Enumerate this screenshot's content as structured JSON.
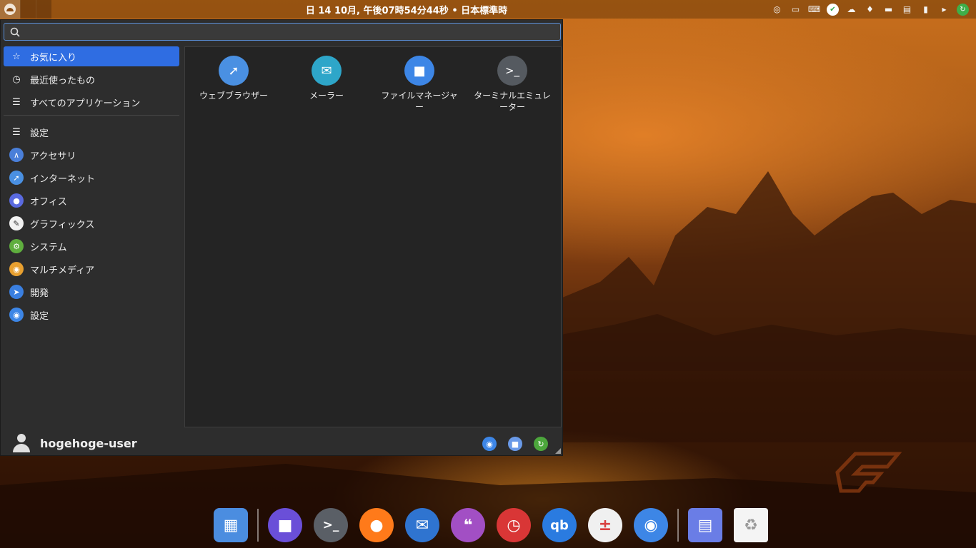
{
  "top_panel": {
    "clock_text": "日 14 10月, 午後07時54分44秒 • 日本標準時",
    "tray_icons": [
      "lightbulb-icon",
      "display-icon",
      "keyboard-icon",
      "shield-icon",
      "network-icon",
      "bell-icon",
      "drive-icon",
      "clipboard-icon",
      "battery-icon",
      "volume-icon",
      "update-icon"
    ]
  },
  "launcher": {
    "search_placeholder": "",
    "categories": [
      {
        "label": "お気に入り",
        "icon": "star-icon",
        "active": true
      },
      {
        "label": "最近使ったもの",
        "icon": "clock-icon",
        "active": false
      },
      {
        "label": "すべてのアプリケーション",
        "icon": "list-icon",
        "active": false
      },
      {
        "label": "設定",
        "icon": "list-icon",
        "active": false
      },
      {
        "label": "アクセサリ",
        "icon": "accessories-icon",
        "active": false
      },
      {
        "label": "インターネット",
        "icon": "compass-icon",
        "active": false
      },
      {
        "label": "オフィス",
        "icon": "office-icon",
        "active": false
      },
      {
        "label": "グラフィックス",
        "icon": "graphics-icon",
        "active": false
      },
      {
        "label": "システム",
        "icon": "gear-icon",
        "active": false
      },
      {
        "label": "マルチメディア",
        "icon": "multimedia-icon",
        "active": false
      },
      {
        "label": "開発",
        "icon": "development-icon",
        "active": false
      },
      {
        "label": "設定",
        "icon": "settings-toggle-icon",
        "active": false
      }
    ],
    "favorites": [
      {
        "label": "ウェブブラウザー",
        "icon": "compass-icon",
        "color": "#4a90e2"
      },
      {
        "label": "メーラー",
        "icon": "mail-icon",
        "color": "#2ea6c9"
      },
      {
        "label": "ファイルマネージャー",
        "icon": "folder-icon",
        "color": "#3d86e6"
      },
      {
        "label": "ターミナルエミュレーター",
        "icon": "terminal-icon",
        "color": "#555a60"
      }
    ],
    "user_name": "hogehoge-user",
    "session_buttons": [
      "settings-icon",
      "lock-icon",
      "logout-icon"
    ]
  },
  "dock": {
    "items": [
      {
        "name": "workspaces-icon",
        "color": "#4b8de0"
      },
      {
        "name": "files-icon",
        "color": "#6a4fd8"
      },
      {
        "name": "terminal-icon",
        "color": "#5a5f66"
      },
      {
        "name": "firefox-icon",
        "color": "#ff7a1a"
      },
      {
        "name": "thunderbird-icon",
        "color": "#2f74d0"
      },
      {
        "name": "notes-icon",
        "color": "#a24fc4"
      },
      {
        "name": "timeshift-icon",
        "color": "#d93636"
      },
      {
        "name": "qbittorrent-icon",
        "color": "#2a7be0"
      },
      {
        "name": "calculator-icon",
        "color": "#f0f0f0"
      },
      {
        "name": "toggle-settings-icon",
        "color": "#3d86e6"
      },
      {
        "name": "folder-window-icon",
        "color": "#6a7de6"
      },
      {
        "name": "trash-icon",
        "color": "#f4f4f4"
      }
    ]
  }
}
